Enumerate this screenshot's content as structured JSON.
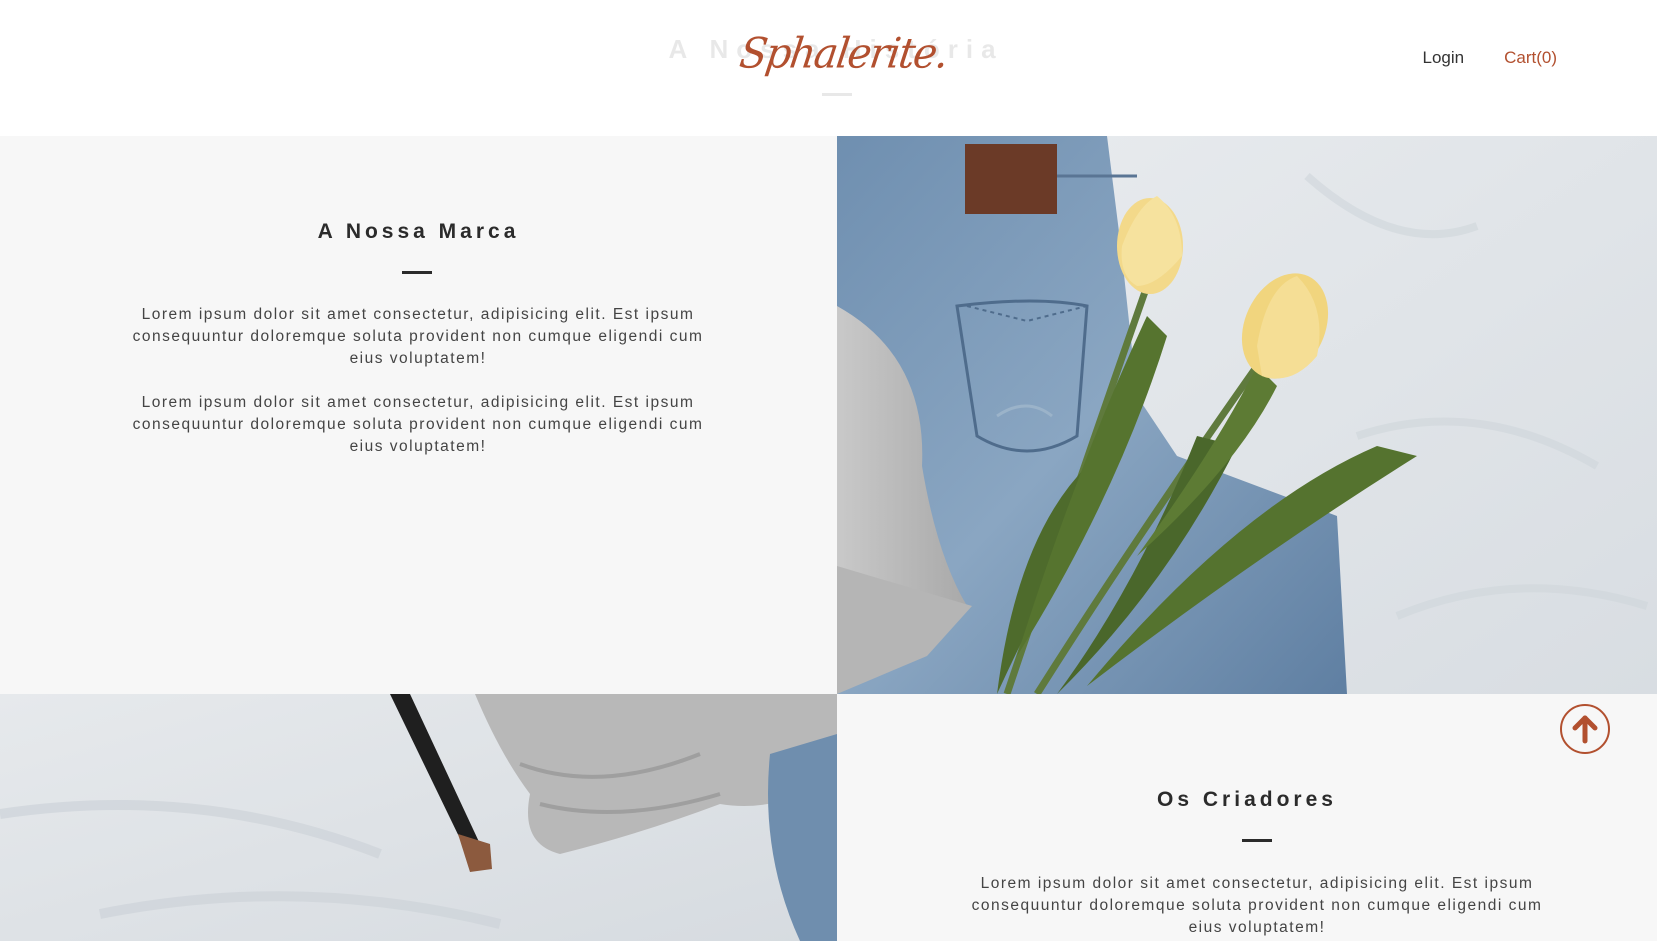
{
  "header": {
    "ghost_title": "A Nossa História",
    "logo_text": "Sphalerite.",
    "nav": {
      "login": "Login",
      "cart": "Cart(0)"
    }
  },
  "sections": {
    "brand": {
      "title": "A Nossa Marca",
      "paragraphs": [
        "Lorem ipsum dolor sit amet consectetur, adipisicing elit. Est ipsum consequuntur doloremque soluta provident non cumque eligendi cum eius voluptatem!",
        "Lorem ipsum dolor sit amet consectetur, adipisicing elit. Est ipsum consequuntur doloremque soluta provident non cumque eligendi cum eius voluptatem!"
      ]
    },
    "creators": {
      "title": "Os Criadores",
      "paragraphs": [
        "Lorem ipsum dolor sit amet consectetur, adipisicing elit. Est ipsum consequuntur doloremque soluta provident non cumque eligendi cum eius voluptatem!"
      ]
    }
  },
  "icons": {
    "scroll_top": "arrow-up-icon"
  },
  "colors": {
    "accent": "#b2502f",
    "panel_bg": "#f7f7f7",
    "text_dark": "#2b2b2b"
  }
}
